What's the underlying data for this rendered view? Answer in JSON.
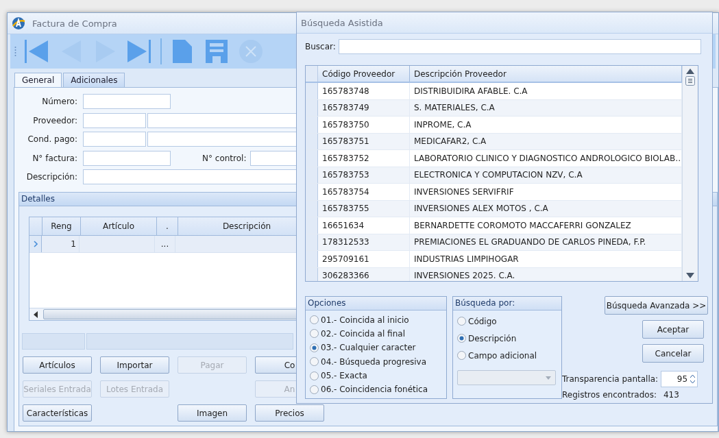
{
  "main_window": {
    "title": "Factura de Compra",
    "toolbar": [
      {
        "kind": "first",
        "disabled": false
      },
      {
        "kind": "prev",
        "disabled": true
      },
      {
        "kind": "next",
        "disabled": true
      },
      {
        "kind": "last",
        "disabled": false
      },
      {
        "kind": "separator"
      },
      {
        "kind": "new",
        "disabled": false
      },
      {
        "kind": "save",
        "disabled": false
      },
      {
        "kind": "cancel",
        "disabled": true
      }
    ],
    "tabs": [
      {
        "label": "General",
        "selected": true
      },
      {
        "label": "Adicionales",
        "selected": false
      }
    ],
    "form": [
      {
        "kind": "short",
        "label": "Número:"
      },
      {
        "kind": "pair",
        "label": "Proveedor:"
      },
      {
        "kind": "pair",
        "label": "Cond. pago:"
      },
      {
        "kind": "split",
        "label": "N° factura:",
        "second_label": "N° control:"
      },
      {
        "kind": "wide",
        "label": "Descripción:"
      }
    ],
    "details": {
      "title": "Detalles",
      "columns": [
        "Reng",
        "Artículo",
        ".",
        "Descripción"
      ],
      "rows": [
        {
          "reng": "1",
          "lookup": "...",
          "current": true
        }
      ]
    },
    "buttons": [
      [
        {
          "kind": "button",
          "label": "Artículos",
          "disabled": false
        },
        {
          "kind": "button",
          "label": "Importar",
          "disabled": false
        },
        {
          "kind": "button",
          "label": "Pagar",
          "disabled": true
        },
        {
          "kind": "button",
          "label": "Co",
          "disabled": false
        }
      ],
      [
        {
          "kind": "button",
          "label": "Seriales Entrada",
          "disabled": true
        },
        {
          "kind": "button",
          "label": "Lotes Entrada",
          "disabled": true
        },
        {
          "kind": "gap"
        },
        {
          "kind": "button",
          "label": "An",
          "disabled": true
        }
      ],
      [
        {
          "kind": "button",
          "label": "Características",
          "disabled": false
        },
        {
          "kind": "gap"
        },
        {
          "kind": "button",
          "label": "Imagen",
          "disabled": false
        },
        {
          "kind": "button",
          "label": "Precios",
          "disabled": false
        }
      ]
    ]
  },
  "dialog": {
    "title": "Búsqueda Asistida",
    "search": {
      "label": "Buscar:"
    },
    "grid": {
      "columns": [
        "Código Proveedor",
        "Descripción Proveedor"
      ],
      "rows": [
        {
          "code": "165783748",
          "name": "DISTRIBUIDIRA AFABLE. C.A"
        },
        {
          "code": "165783749",
          "name": "S. MATERIALES, C.A"
        },
        {
          "code": "165783750",
          "name": "INPROME, C.A"
        },
        {
          "code": "165783751",
          "name": "MEDICAFAR2, C.A"
        },
        {
          "code": "165783752",
          "name": "LABORATORIO CLINICO Y DIAGNOSTICO ANDROLOGICO BIOLAB…"
        },
        {
          "code": "165783753",
          "name": "ELECTRONICA Y COMPUTACION NZV, C.A"
        },
        {
          "code": "165783754",
          "name": "INVERSIONES SERVIFRIF"
        },
        {
          "code": "165783755",
          "name": "INVERSIONES ALEX MOTOS , C.A"
        },
        {
          "code": "16651634",
          "name": "BERNARDETTE COROMOTO MACCAFERRI GONZALEZ"
        },
        {
          "code": "178312533",
          "name": "PREMIACIONES EL GRADUANDO DE CARLOS PINEDA, F.P."
        },
        {
          "code": "295709161",
          "name": "INDUSTRIAS LIMPIHOGAR"
        },
        {
          "code": "306283366",
          "name": "INVERSIONES 2025. C.A."
        }
      ]
    },
    "options": {
      "title": "Opciones",
      "items": [
        {
          "label": "01.- Coincida al inicio",
          "selected": false
        },
        {
          "label": "02.- Coincida al final",
          "selected": false
        },
        {
          "label": "03.- Cualquier caracter",
          "selected": true
        },
        {
          "label": "04.- Búsqueda progresiva",
          "selected": false
        },
        {
          "label": "05.- Exacta",
          "selected": false
        },
        {
          "label": "06.- Coincidencia fonética",
          "selected": false
        }
      ]
    },
    "search_by": {
      "title": "Búsqueda por:",
      "items": [
        {
          "label": "Código",
          "selected": false
        },
        {
          "label": "Descripción",
          "selected": true
        },
        {
          "label": "Campo adicional",
          "selected": false
        }
      ]
    },
    "advanced_button": "Búsqueda Avanzada >>",
    "accept_button": "Aceptar",
    "cancel_button": "Cancelar",
    "transparency": {
      "label": "Transparencia pantalla:",
      "value": "95"
    },
    "records": {
      "label": "Registros encontrados:",
      "value": "413"
    }
  }
}
